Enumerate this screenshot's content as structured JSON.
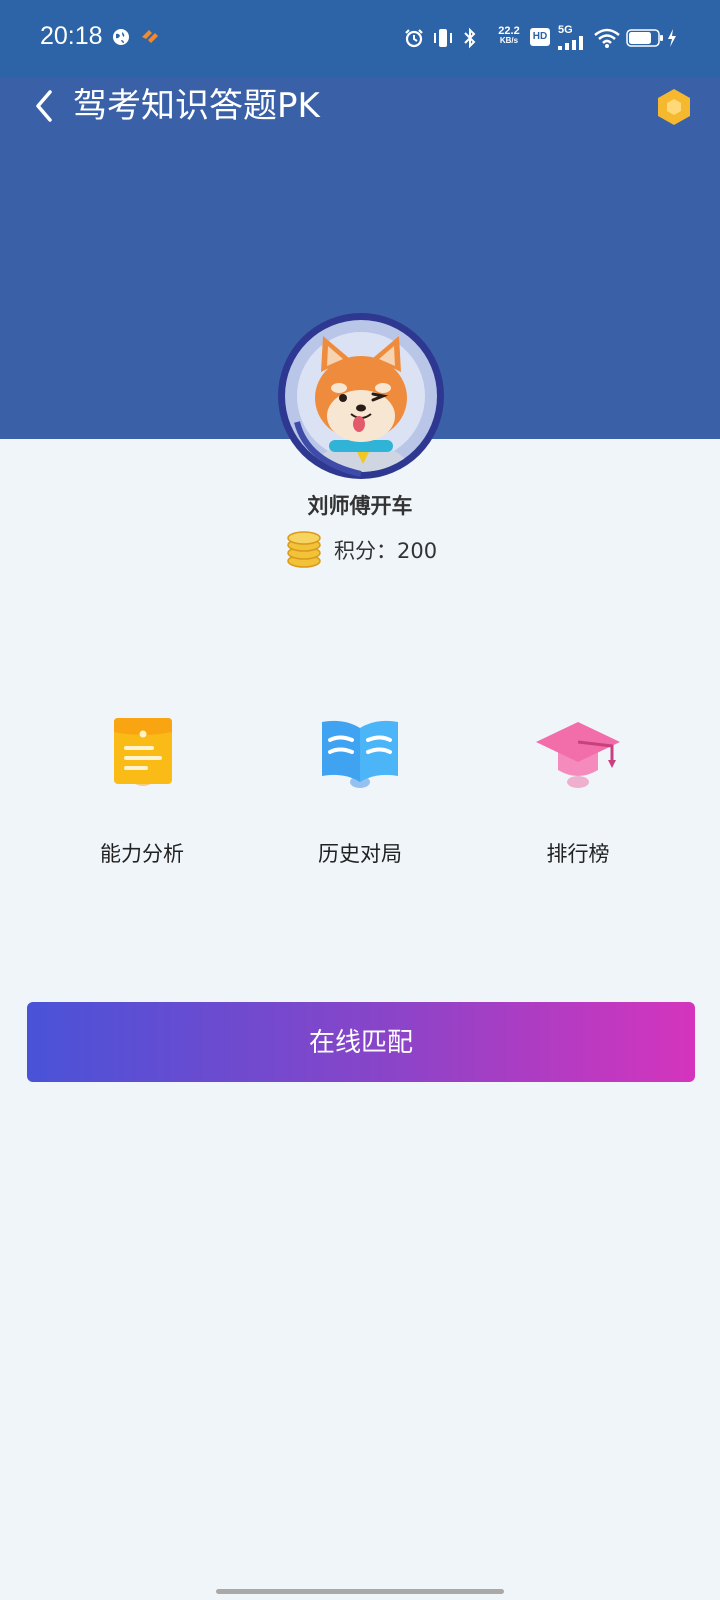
{
  "status_bar": {
    "time": "20:18",
    "net_speed_value": "22.2",
    "net_speed_unit": "KB/s",
    "hd_label": "HD",
    "network_label": "5G",
    "icons": [
      "globe-icon",
      "app-notification-icon",
      "alarm-icon",
      "vibrate-icon",
      "bluetooth-icon",
      "signal-icon",
      "wifi-icon",
      "battery-icon",
      "charging-icon"
    ]
  },
  "header": {
    "title": "驾考知识答题PK",
    "back_icon": "chevron-left-icon",
    "action_icon": "hexagon-icon"
  },
  "profile": {
    "name": "刘师傅开车",
    "points_label": "积分：200"
  },
  "menu": [
    {
      "label": "能力分析",
      "icon": "document-icon"
    },
    {
      "label": "历史对局",
      "icon": "book-icon"
    },
    {
      "label": "排行榜",
      "icon": "graduation-cap-icon"
    }
  ],
  "match_button_label": "在线匹配",
  "colors": {
    "status_bar": "#2d63a7",
    "header": "#3a61a8",
    "page_bg": "#eff5f9",
    "button_gradient_start": "#4953d8",
    "button_gradient_end": "#d534bd"
  }
}
